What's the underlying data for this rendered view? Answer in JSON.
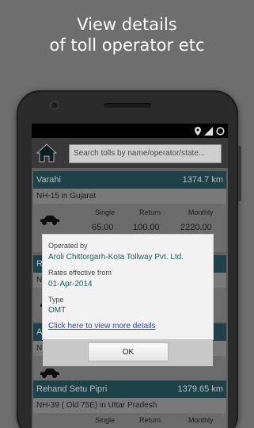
{
  "promo": {
    "line1": "View details",
    "line2": "of toll operator etc"
  },
  "search": {
    "placeholder": "Search tolls by name/operator/state..."
  },
  "rate_headers": {
    "single": "Single",
    "return": "Return",
    "monthly": "Monthly"
  },
  "cards": [
    {
      "name": "Varahi",
      "distance": "1374.7 km",
      "highway": "NH-15 in Gujarat",
      "single": "65.00",
      "return": "100.00",
      "monthly": "2220.00"
    },
    {
      "name": "Ra",
      "highway": "NH"
    },
    {
      "name": "Ar",
      "highway": "NI"
    },
    {
      "name": "Rehand Setu Pipri",
      "distance": "1379.65 km",
      "highway": "NH-39 ( Old 75E) in Uttar Pradesh"
    }
  ],
  "dialog": {
    "operated_label": "Operated by",
    "operator": "Aroli  Chittorgarh-Kota Tollway Pvt. Ltd.",
    "rates_label": "Rates effective from",
    "rates_date": "01-Apr-2014",
    "type_label": "Type",
    "type_value": "OMT",
    "link": "Click here to view more details",
    "ok": "OK"
  },
  "colors": {
    "accent": "#234a55",
    "link": "#2a4bb8",
    "value": "#1f5a5e"
  }
}
